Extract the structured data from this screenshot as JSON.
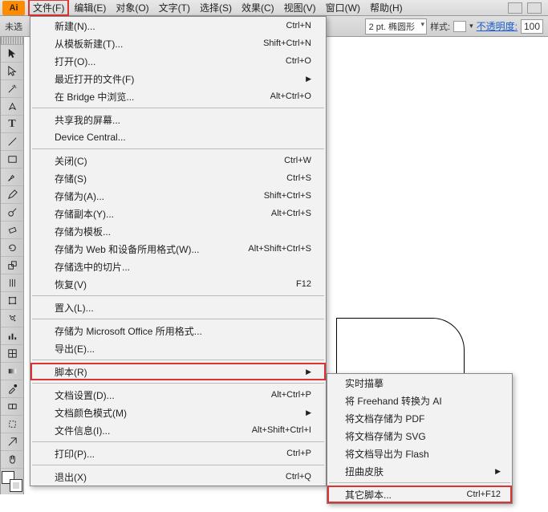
{
  "logo": "Ai",
  "menubar": [
    "文件(F)",
    "编辑(E)",
    "对象(O)",
    "文字(T)",
    "选择(S)",
    "效果(C)",
    "视图(V)",
    "窗口(W)",
    "帮助(H)"
  ],
  "optbar": {
    "left": "未选",
    "stroke_label": "2 pt. 椭圆形",
    "style_label": "样式:",
    "opacity_label": "不透明度:",
    "opacity_value": "100"
  },
  "file_menu": [
    {
      "t": "item",
      "label": "新建(N)...",
      "shortcut": "Ctrl+N"
    },
    {
      "t": "item",
      "label": "从模板新建(T)...",
      "shortcut": "Shift+Ctrl+N"
    },
    {
      "t": "item",
      "label": "打开(O)...",
      "shortcut": "Ctrl+O"
    },
    {
      "t": "item",
      "label": "最近打开的文件(F)",
      "sub": true
    },
    {
      "t": "item",
      "label": "在 Bridge 中浏览...",
      "shortcut": "Alt+Ctrl+O"
    },
    {
      "t": "sep"
    },
    {
      "t": "item",
      "label": "共享我的屏幕..."
    },
    {
      "t": "item",
      "label": "Device Central..."
    },
    {
      "t": "sep"
    },
    {
      "t": "item",
      "label": "关闭(C)",
      "shortcut": "Ctrl+W"
    },
    {
      "t": "item",
      "label": "存储(S)",
      "shortcut": "Ctrl+S"
    },
    {
      "t": "item",
      "label": "存储为(A)...",
      "shortcut": "Shift+Ctrl+S"
    },
    {
      "t": "item",
      "label": "存储副本(Y)...",
      "shortcut": "Alt+Ctrl+S"
    },
    {
      "t": "item",
      "label": "存储为模板..."
    },
    {
      "t": "item",
      "label": "存储为 Web 和设备所用格式(W)...",
      "shortcut": "Alt+Shift+Ctrl+S"
    },
    {
      "t": "item",
      "label": "存储选中的切片..."
    },
    {
      "t": "item",
      "label": "恢复(V)",
      "shortcut": "F12"
    },
    {
      "t": "sep"
    },
    {
      "t": "item",
      "label": "置入(L)..."
    },
    {
      "t": "sep"
    },
    {
      "t": "item",
      "label": "存储为 Microsoft Office 所用格式..."
    },
    {
      "t": "item",
      "label": "导出(E)..."
    },
    {
      "t": "sep"
    },
    {
      "t": "item",
      "label": "脚本(R)",
      "sub": true,
      "hl": true
    },
    {
      "t": "sep"
    },
    {
      "t": "item",
      "label": "文档设置(D)...",
      "shortcut": "Alt+Ctrl+P"
    },
    {
      "t": "item",
      "label": "文档颜色模式(M)",
      "sub": true
    },
    {
      "t": "item",
      "label": "文件信息(I)...",
      "shortcut": "Alt+Shift+Ctrl+I"
    },
    {
      "t": "sep"
    },
    {
      "t": "item",
      "label": "打印(P)...",
      "shortcut": "Ctrl+P"
    },
    {
      "t": "sep"
    },
    {
      "t": "item",
      "label": "退出(X)",
      "shortcut": "Ctrl+Q"
    }
  ],
  "script_submenu": [
    {
      "label": "实时描摹"
    },
    {
      "label": "将 Freehand 转换为 AI"
    },
    {
      "label": "将文档存储为 PDF"
    },
    {
      "label": "将文档存储为 SVG"
    },
    {
      "label": "将文档导出为 Flash"
    },
    {
      "label": "扭曲皮肤",
      "sub": true
    },
    {
      "sep": true
    },
    {
      "label": "其它脚本...",
      "shortcut": "Ctrl+F12",
      "hl": true
    }
  ]
}
